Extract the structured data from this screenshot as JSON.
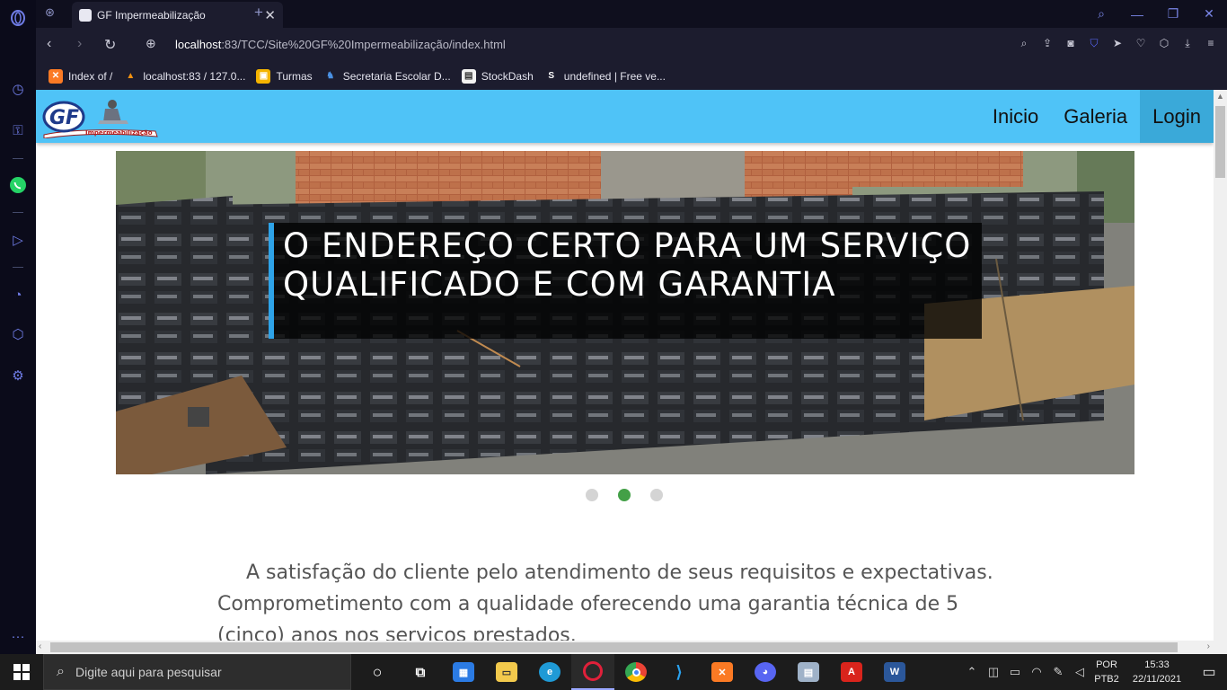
{
  "browser": {
    "tab_title": "GF Impermeabilização",
    "url_host": "localhost",
    "url_path": ":83/TCC/Site%20GF%20Impermeabilização/index.html",
    "bookmarks": [
      {
        "label": "Index of /",
        "icon": "xampp-icon",
        "color": "#fb7a24"
      },
      {
        "label": "localhost:83 / 127.0...",
        "icon": "phpmyadmin-icon",
        "color": "#f29111"
      },
      {
        "label": "Turmas",
        "icon": "classroom-icon",
        "color": "#1e8e3e"
      },
      {
        "label": "Secretaria Escolar D...",
        "icon": "secretaria-icon",
        "color": "#4a90e2"
      },
      {
        "label": "StockDash",
        "icon": "document-icon",
        "color": "#ffffff"
      },
      {
        "label": "undefined | Free ve...",
        "icon": "freevector-icon",
        "color": "#ffffff"
      }
    ]
  },
  "site": {
    "logo_text": "GF",
    "logo_sub": "Impermeabilização",
    "nav": [
      "Inicio",
      "Galeria",
      "Login"
    ],
    "slide_caption": "O ENDEREÇO CERTO PARA UM SERVIÇO QUALIFICADO E COM GARANTIA",
    "slide_count": 3,
    "active_slide": 2,
    "intro": "A satisfação do cliente pelo atendimento de seus requisitos e expectativas. Comprometimento com a qualidade oferecendo uma garantia técnica de 5 (cinco) anos nos serviços prestados."
  },
  "taskbar": {
    "search_placeholder": "Digite aqui para pesquisar",
    "lang_top": "POR",
    "lang_bottom": "PTB2",
    "time": "15:33",
    "date": "22/11/2021"
  },
  "colors": {
    "header": "#4fc3f7",
    "nav_active": "#3aa9d9",
    "caption_accent": "#2ea3e8",
    "dot_active": "#43a047"
  }
}
